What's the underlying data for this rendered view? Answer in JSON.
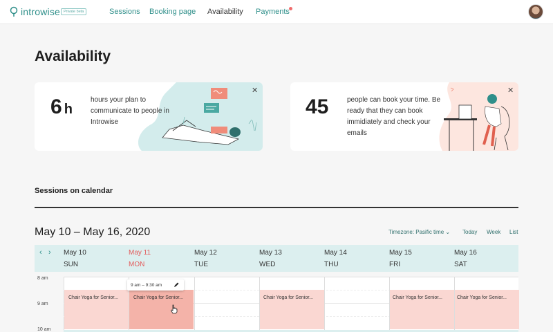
{
  "header": {
    "logo": "introwise",
    "badge": "Private beta",
    "nav": [
      {
        "label": "Sessions"
      },
      {
        "label": "Booking page"
      },
      {
        "label": "Availability"
      },
      {
        "label": "Payments"
      }
    ]
  },
  "page": {
    "title": "Availability"
  },
  "cards": [
    {
      "number": "6",
      "unit": "h",
      "text": "hours your plan to communicate to people in Introwise"
    },
    {
      "number": "45",
      "unit": "",
      "text": "people can book your time. Be ready that they can book immidiately and check your emails"
    }
  ],
  "section": {
    "title": "Sessions on calendar"
  },
  "calendar": {
    "range": "May 10 – May 16, 2020",
    "timezone": "Timezone: Pasific time",
    "today": "Today",
    "week": "Week",
    "list": "List",
    "days": [
      {
        "date": "May 10",
        "dow": "SUN"
      },
      {
        "date": "May 11",
        "dow": "MON"
      },
      {
        "date": "May 12",
        "dow": "TUE"
      },
      {
        "date": "May 13",
        "dow": "WED"
      },
      {
        "date": "May 14",
        "dow": "THU"
      },
      {
        "date": "May 15",
        "dow": "FRI"
      },
      {
        "date": "May 16",
        "dow": "SAT"
      }
    ],
    "times": [
      "8 am",
      "9 am",
      "10 am"
    ],
    "event_title": "Chair Yoga for Senior...",
    "tooltip_time": "9 am – 9:30 am"
  },
  "colors": {
    "accent": "#2f8f8a",
    "event": "#fad7d2",
    "event_active": "#f4b3a9",
    "today": "#e35b5b"
  }
}
